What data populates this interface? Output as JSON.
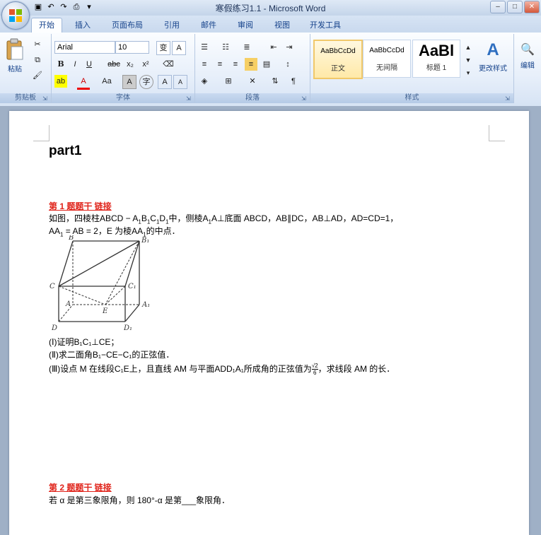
{
  "window": {
    "title": "寒假练习1.1 - Microsoft Word"
  },
  "tabs": [
    "开始",
    "插入",
    "页面布局",
    "引用",
    "邮件",
    "审阅",
    "视图",
    "开发工具"
  ],
  "ribbon": {
    "clipboard": {
      "paste": "粘贴",
      "label": "剪贴板"
    },
    "font": {
      "name": "Arial",
      "size": "10",
      "label": "字体",
      "bold": "B",
      "italic": "I",
      "underline": "U",
      "strike": "abc",
      "sub": "x₂",
      "sup": "x²",
      "fontcolor": "A",
      "changecase": "Aa",
      "clear": "A",
      "grow": "A",
      "shrink": "A"
    },
    "paragraph": {
      "label": "段落"
    },
    "styles": {
      "label": "样式",
      "items": [
        {
          "sample": "AaBbCcDd",
          "name": "正文"
        },
        {
          "sample": "AaBbCcDd",
          "name": "无间隔"
        },
        {
          "sample": "AaBl",
          "name": "标题 1"
        }
      ],
      "change": "更改样式"
    },
    "editing": {
      "label": "编辑"
    }
  },
  "document": {
    "heading": "part1",
    "q1": {
      "title": "第 1 题题干  链接",
      "figure_labels": {
        "B": "B",
        "B1": "B₁",
        "C": "C",
        "C1": "C₁",
        "A": "A",
        "A1": "A₁",
        "E": "E",
        "D": "D",
        "D1": "D₁"
      },
      "part1": "(Ⅰ)证明B₁C₁⊥CE；",
      "part2": "(Ⅱ)求二面角B₁−CE−C₁的正弦值．",
      "part3_pre": "(Ⅲ)设点 M 在线段C₁E上，且直线 AM 与平面ADD₁A₁所成角的正弦值为",
      "part3_frac_num": "√2",
      "part3_frac_den": "6",
      "part3_post": "，求线段 AM 的长．"
    },
    "q2": {
      "title": "第 2 题题干  链接",
      "text": "若 α 是第三象限角，则 180°-α 是第___象限角．"
    }
  }
}
